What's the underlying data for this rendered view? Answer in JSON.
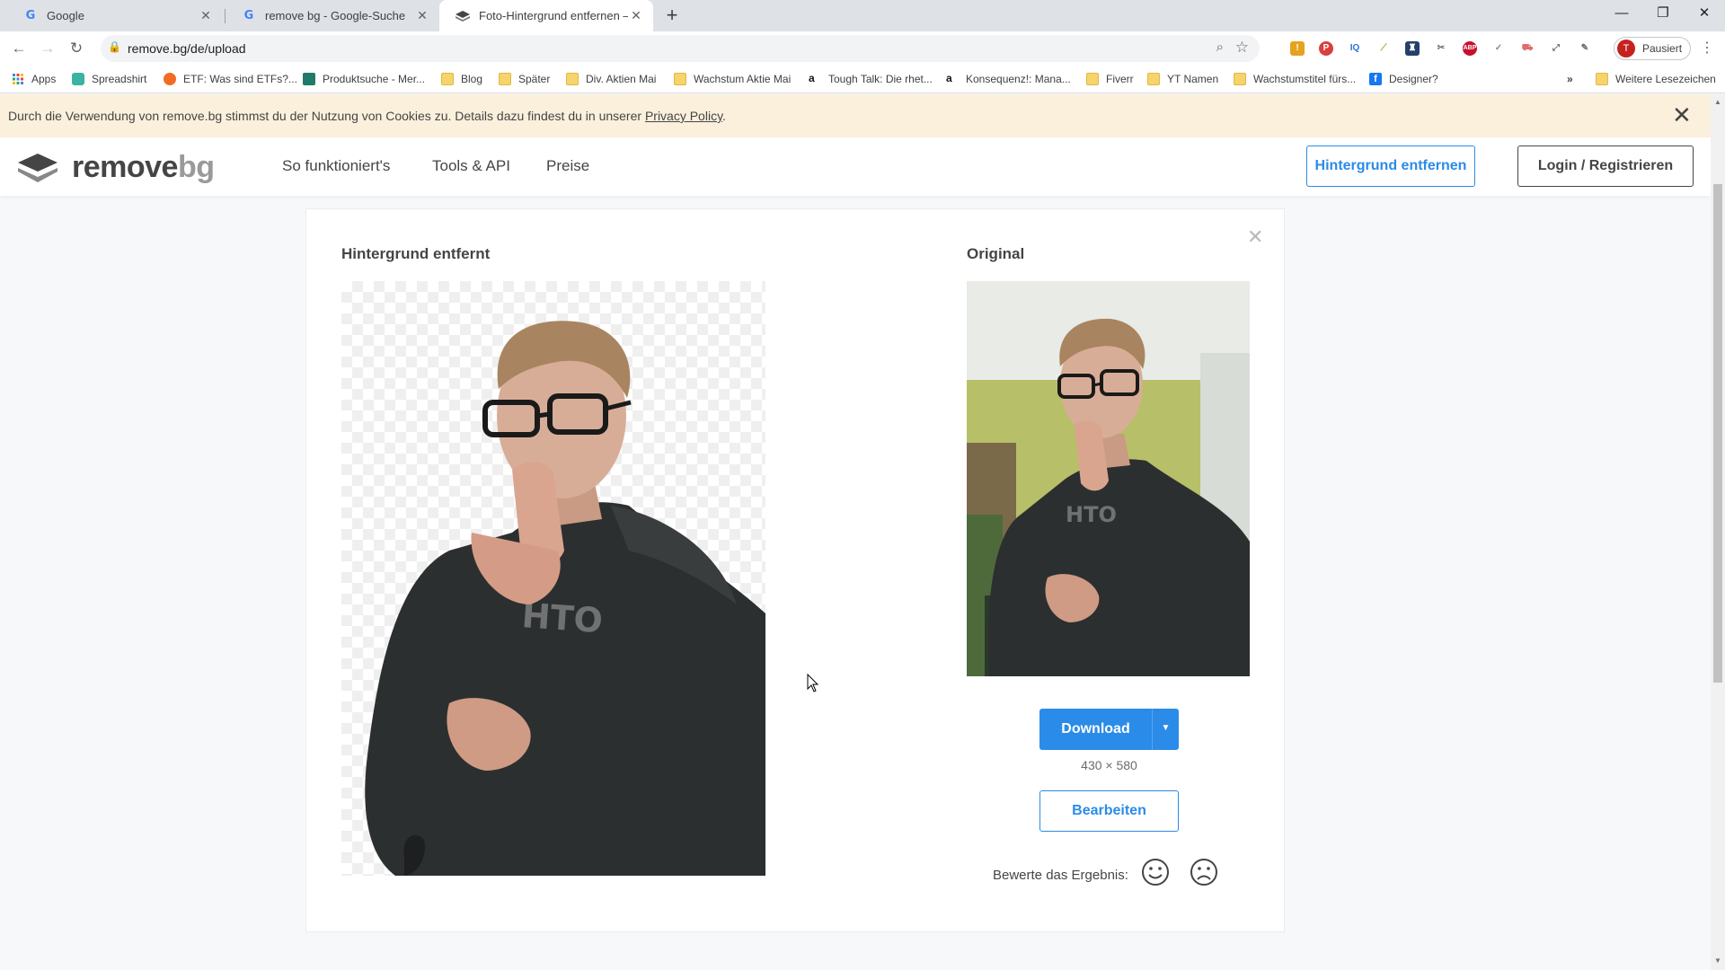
{
  "browser": {
    "tabs": [
      {
        "title": "Google",
        "favicon": "google-g-icon",
        "active": false
      },
      {
        "title": "remove bg - Google-Suche",
        "favicon": "google-g-icon",
        "active": false
      },
      {
        "title": "Foto-Hintergrund entfernen – re",
        "favicon": "removebg-logo-icon",
        "active": true
      }
    ],
    "url": "remove.bg/de/upload",
    "profile_initial": "T",
    "profile_label": "Pausiert",
    "bookmarks": [
      {
        "label": "Apps",
        "icon": "apps-grid-icon"
      },
      {
        "label": "Spreadshirt",
        "icon": "spreadshirt-icon"
      },
      {
        "label": "ETF: Was sind ETFs?...",
        "icon": "etf-icon"
      },
      {
        "label": "Produktsuche - Mer...",
        "icon": "merch-icon"
      },
      {
        "label": "Blog",
        "icon": "folder-icon"
      },
      {
        "label": "Später",
        "icon": "folder-icon"
      },
      {
        "label": "Div. Aktien Mai",
        "icon": "folder-icon"
      },
      {
        "label": "Wachstum Aktie Mai",
        "icon": "folder-icon"
      },
      {
        "label": "Tough Talk: Die rhet...",
        "icon": "amazon-icon"
      },
      {
        "label": "Konsequenz!: Mana...",
        "icon": "amazon-icon"
      },
      {
        "label": "Fiverr",
        "icon": "folder-icon"
      },
      {
        "label": "YT Namen",
        "icon": "folder-icon"
      },
      {
        "label": "Wachstumstitel fürs...",
        "icon": "folder-icon"
      },
      {
        "label": "Designer?",
        "icon": "facebook-icon"
      }
    ],
    "bookmarks_overflow": "»",
    "other_bookmarks": "Weitere Lesezeichen"
  },
  "cookie_banner": {
    "text": "Durch die Verwendung von remove.bg stimmst du der Nutzung von Cookies zu. Details dazu findest du in unserer ",
    "link": "Privacy Policy",
    "suffix": "."
  },
  "site": {
    "logo_main": "remove",
    "logo_accent": "bg",
    "nav": [
      "So funktioniert's",
      "Tools & API",
      "Preise"
    ],
    "cta_primary": "Hintergrund entfernen",
    "cta_login": "Login / Registrieren"
  },
  "result": {
    "removed_title": "Hintergrund entfernt",
    "original_title": "Original",
    "download_label": "Download",
    "dimensions": "430 × 580",
    "edit_label": "Bearbeiten",
    "rate_label": "Bewerte das Ergebnis:"
  },
  "colors": {
    "accent_blue": "#2b8be8",
    "cookie_bg": "#fbf0dc",
    "text_dark": "#454545"
  }
}
